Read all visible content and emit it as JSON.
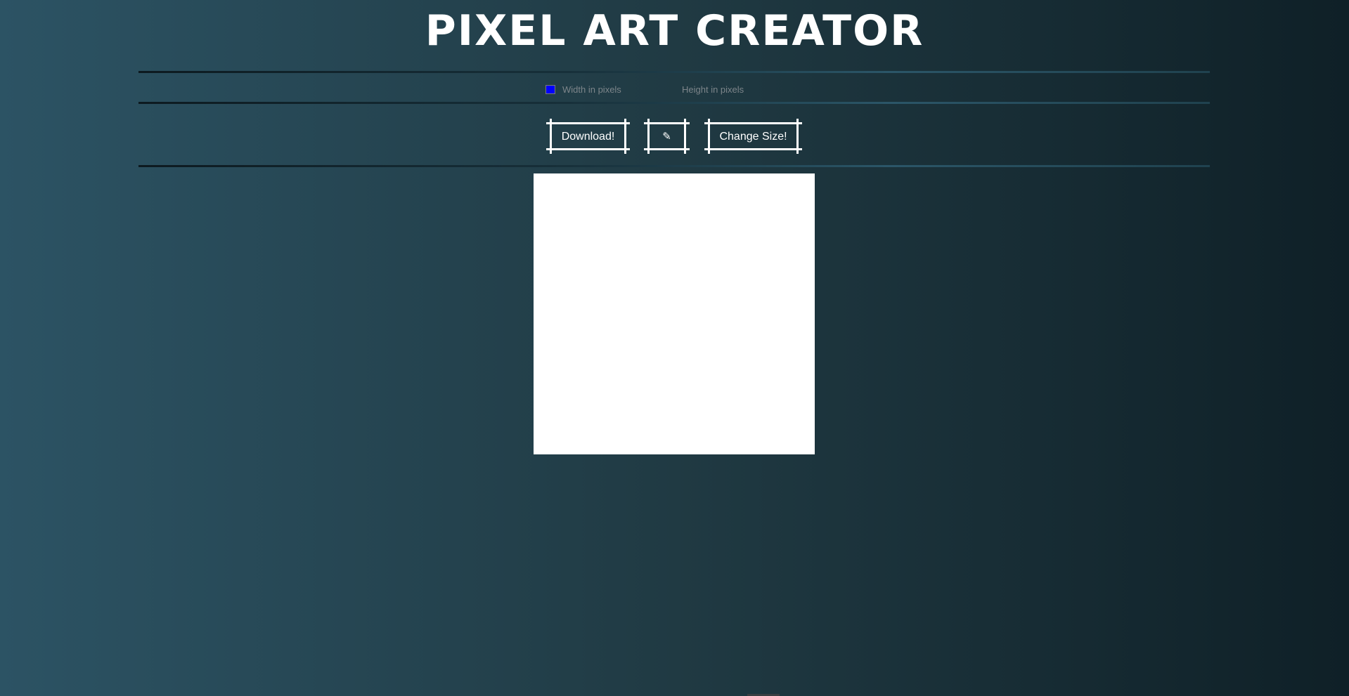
{
  "app": {
    "title": "PIXEL ART CREATOR"
  },
  "controls": {
    "color_value": "#0000ff",
    "width_placeholder": "Width in pixels",
    "height_placeholder": "Height in pixels"
  },
  "toolbar": {
    "download_label": "Download!",
    "eraser_icon": "eraser-icon",
    "eraser_glyph": "✎",
    "change_size_label": "Change Size!"
  },
  "canvas": {
    "background": "#ffffff"
  },
  "theme": {
    "gradient_start": "#2c5364",
    "gradient_mid": "#203a43",
    "gradient_end": "#0f2027",
    "text": "#ffffff"
  }
}
